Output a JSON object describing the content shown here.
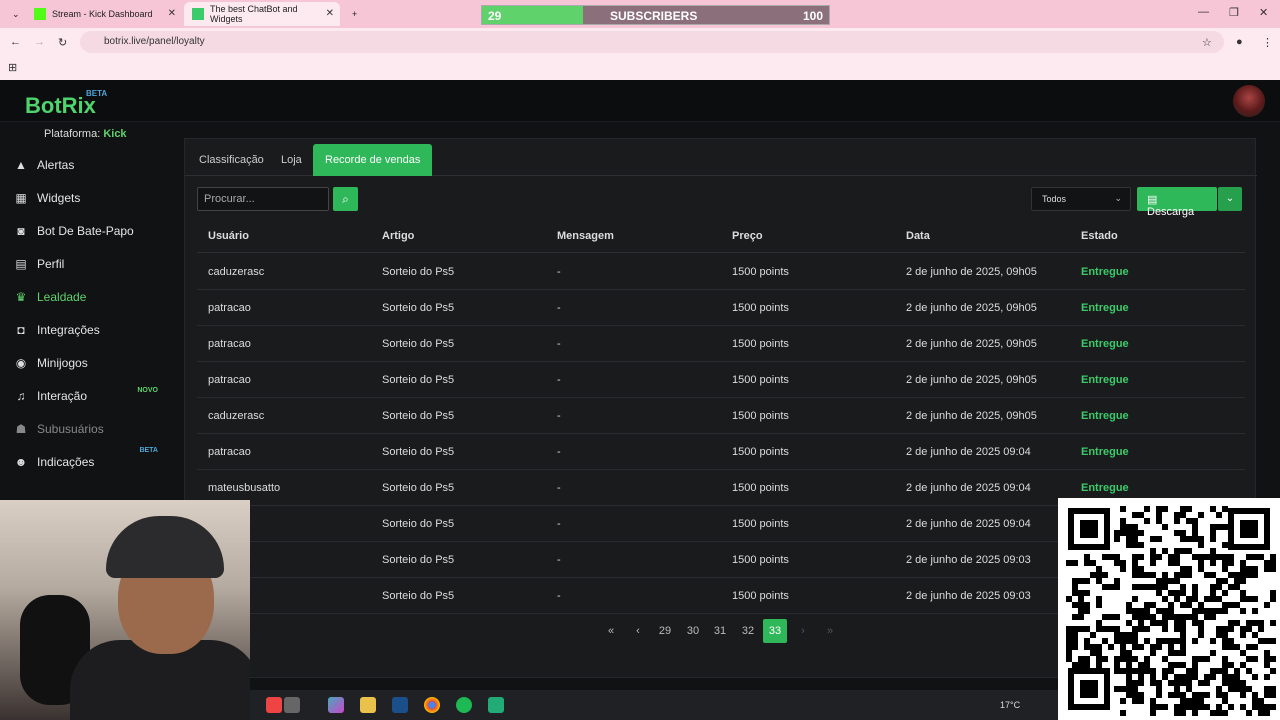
{
  "browser": {
    "tabs": [
      {
        "label": "Stream - Kick Dashboard",
        "fav_color": "#53fc18"
      },
      {
        "label": "The best ChatBot and Widgets",
        "fav_color": "#3ccb6a"
      }
    ],
    "new_tab": "+",
    "url": "botrix.live/panel/loyalty",
    "subscribers": {
      "label": "SUBSCRIBERS",
      "current": "29",
      "goal": "100",
      "progress": 0.29
    }
  },
  "app": {
    "logo": "BotRix",
    "logo_badge": "BETA",
    "platform_label": "Plataforma:",
    "platform_value": "Kick",
    "accent": "#2fb85a"
  },
  "sidebar": {
    "items": [
      {
        "label": "Alertas",
        "icon": "warning-icon"
      },
      {
        "label": "Widgets",
        "icon": "grid-icon"
      },
      {
        "label": "Bot De Bate-Papo",
        "icon": "robot-icon"
      },
      {
        "label": "Perfil",
        "icon": "id-card-icon"
      },
      {
        "label": "Lealdade",
        "icon": "trophy-icon",
        "active": true
      },
      {
        "label": "Integrações",
        "icon": "puzzle-icon"
      },
      {
        "label": "Minijogos",
        "icon": "gamepad-icon"
      },
      {
        "label": "Interação",
        "icon": "music-icon",
        "tag": "NOVO"
      },
      {
        "label": "Subusuários",
        "icon": "users-icon",
        "disabled": true
      },
      {
        "label": "Indicações",
        "icon": "user-plus-icon",
        "tag": "BETA"
      }
    ]
  },
  "panel": {
    "tabs": [
      "Classificação",
      "Loja",
      "Recorde de vendas"
    ],
    "active_tab": "Recorde de vendas",
    "search_placeholder": "Procurar...",
    "filter_value": "Todos",
    "download_label": "Descarga",
    "columns": [
      "Usuário",
      "Artigo",
      "Mensagem",
      "Preço",
      "Data",
      "Estado"
    ],
    "rows": [
      [
        "caduzerasc",
        "Sorteio do Ps5",
        "-",
        "1500 points",
        "2 de junho de 2025, 09h05",
        "Entregue"
      ],
      [
        "patracao",
        "Sorteio do Ps5",
        "-",
        "1500 points",
        "2 de junho de 2025, 09h05",
        "Entregue"
      ],
      [
        "patracao",
        "Sorteio do Ps5",
        "-",
        "1500 points",
        "2 de junho de 2025, 09h05",
        "Entregue"
      ],
      [
        "patracao",
        "Sorteio do Ps5",
        "-",
        "1500 points",
        "2 de junho de 2025, 09h05",
        "Entregue"
      ],
      [
        "caduzerasc",
        "Sorteio do Ps5",
        "-",
        "1500 points",
        "2 de junho de 2025, 09h05",
        "Entregue"
      ],
      [
        "patracao",
        "Sorteio do Ps5",
        "-",
        "1500 points",
        "2 de junho de 2025 09:04",
        "Entregue"
      ],
      [
        "mateusbusatto",
        "Sorteio do Ps5",
        "-",
        "1500 points",
        "2 de junho de 2025 09:04",
        "Entregue"
      ],
      [
        "usatto",
        "Sorteio do Ps5",
        "-",
        "1500 points",
        "2 de junho de 2025 09:04",
        ""
      ],
      [
        "",
        "Sorteio do Ps5",
        "-",
        "1500 points",
        "2 de junho de 2025 09:03",
        ""
      ],
      [
        "",
        "Sorteio do Ps5",
        "-",
        "1500 points",
        "2 de junho de 2025 09:03",
        ""
      ]
    ],
    "pagination": {
      "pages": [
        "29",
        "30",
        "31",
        "32",
        "33"
      ],
      "current": "33",
      "first": "«",
      "prev": "‹",
      "next": "›",
      "last": "»"
    }
  },
  "taskbar": {
    "weather": "17°C"
  }
}
